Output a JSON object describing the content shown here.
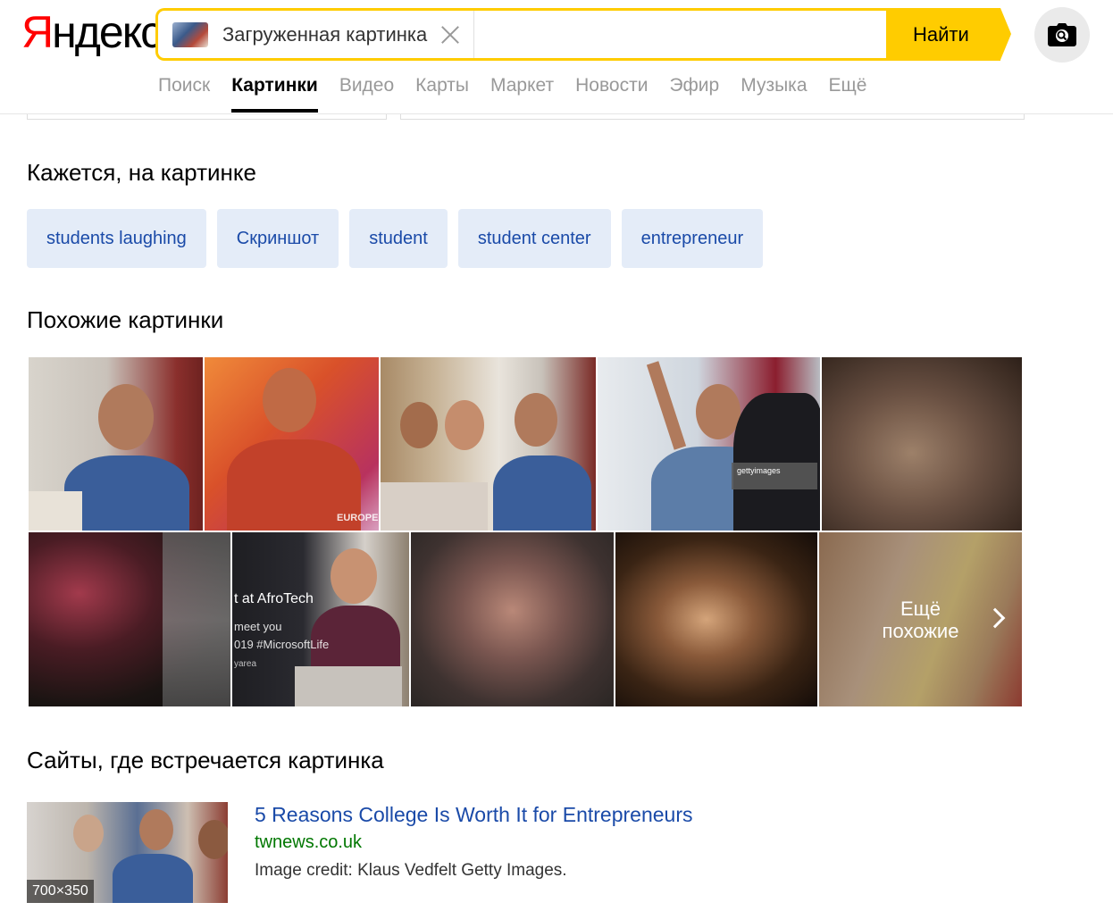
{
  "logo": {
    "first_letter": "Я",
    "rest": "ндекс"
  },
  "search": {
    "chip_label": "Загруженная картинка",
    "input_value": "",
    "button_label": "Найти"
  },
  "tabs": [
    {
      "label": "Поиск",
      "active": false
    },
    {
      "label": "Картинки",
      "active": true
    },
    {
      "label": "Видео",
      "active": false
    },
    {
      "label": "Карты",
      "active": false
    },
    {
      "label": "Маркет",
      "active": false
    },
    {
      "label": "Новости",
      "active": false
    },
    {
      "label": "Эфир",
      "active": false
    },
    {
      "label": "Музыка",
      "active": false
    },
    {
      "label": "Ещё",
      "active": false
    }
  ],
  "tags_section": {
    "title": "Кажется, на картинке",
    "tags": [
      "students laughing",
      "Скриншот",
      "student",
      "student center",
      "entrepreneur"
    ]
  },
  "similar_section": {
    "title": "Похожие картинки",
    "more_label_line1": "Ещё",
    "more_label_line2": "похожие",
    "afrotech_lines": [
      "t at AfroTech",
      "meet you",
      "019 #MicrosoftLife",
      "yarea"
    ],
    "europe_caption": "EUROPE",
    "getty_caption": "gettyimages"
  },
  "sites_section": {
    "title": "Сайты, где встречается картинка",
    "results": [
      {
        "title": "5 Reasons College Is Worth It for Entrepreneurs",
        "domain": "twnews.co.uk",
        "description": "Image credit: Klaus Vedfelt Getty Images.",
        "size": "700×350"
      }
    ]
  },
  "colors": {
    "brand_yellow": "#ffcc00",
    "link_blue": "#1a4aa8",
    "domain_green": "#007700",
    "tag_bg": "#e4ecf8"
  }
}
